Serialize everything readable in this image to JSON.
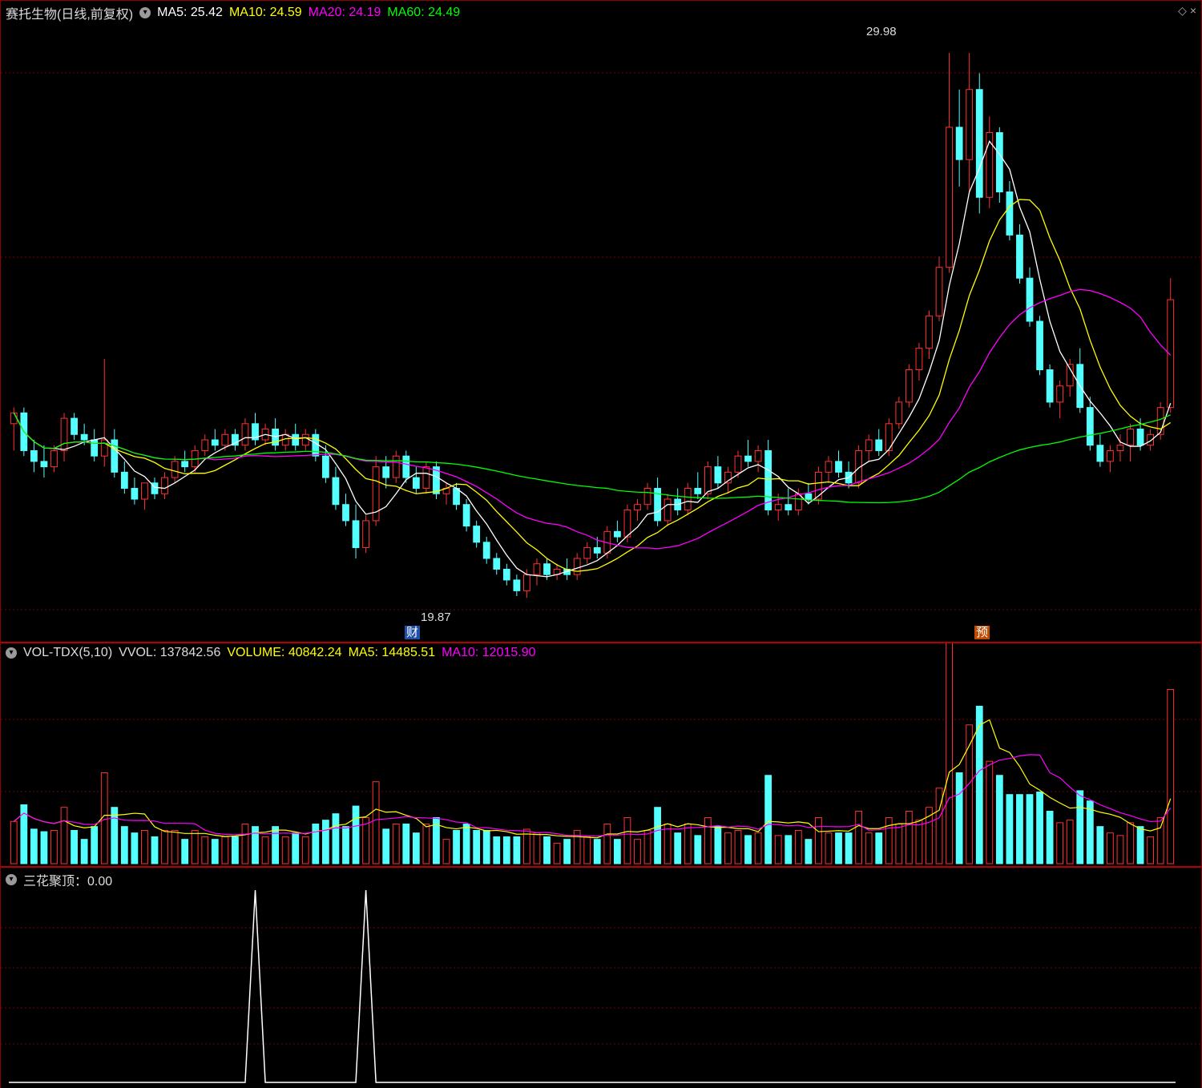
{
  "stock": {
    "title": "赛托生物(日线,前复权)",
    "ma_labels": [
      {
        "text": "MA5: 25.42",
        "color": "#ffffff"
      },
      {
        "text": "MA10: 24.59",
        "color": "#ffff00"
      },
      {
        "text": "MA20: 24.19",
        "color": "#ff00ff"
      },
      {
        "text": "MA60: 24.49",
        "color": "#00ff00"
      }
    ],
    "high_label": "29.98",
    "low_label": "19.87",
    "badge_cai": "财",
    "badge_yu": "预",
    "top_icons": "◇ ×"
  },
  "volume": {
    "name": "VOL-TDX(5,10)",
    "vvol": "VVOL: 137842.56",
    "labels": [
      {
        "text": "VOLUME: 40842.24",
        "color": "#ffff00"
      },
      {
        "text": "MA5: 14485.51",
        "color": "#ffff00"
      },
      {
        "text": "MA10: 12015.90",
        "color": "#ff00ff"
      }
    ]
  },
  "indicator": {
    "label": "三花聚顶：0.00",
    "spike_positions": [
      0.205,
      0.3
    ]
  },
  "colors": {
    "up": "#ff3232",
    "down": "#54ffff",
    "ma5": "#ffffff",
    "ma10": "#ffff00",
    "ma20": "#ff00ff",
    "ma60": "#00ff00"
  },
  "chart_data": {
    "type": "candlestick",
    "price_range": [
      19.5,
      30.5
    ],
    "candles": [
      [
        23.1,
        23.4,
        22.6,
        23.3
      ],
      [
        23.3,
        23.4,
        22.5,
        22.6
      ],
      [
        22.6,
        22.8,
        22.2,
        22.4
      ],
      [
        22.4,
        22.7,
        22.1,
        22.3
      ],
      [
        22.3,
        22.7,
        22.2,
        22.6
      ],
      [
        22.6,
        23.3,
        22.4,
        23.2
      ],
      [
        23.2,
        23.3,
        22.8,
        22.9
      ],
      [
        22.9,
        23.1,
        22.7,
        22.8
      ],
      [
        22.8,
        23.0,
        22.4,
        22.5
      ],
      [
        22.5,
        24.3,
        22.3,
        22.8
      ],
      [
        22.8,
        23.0,
        22.1,
        22.2
      ],
      [
        22.2,
        22.4,
        21.8,
        21.9
      ],
      [
        21.9,
        22.1,
        21.6,
        21.7
      ],
      [
        21.7,
        22.0,
        21.5,
        22.0
      ],
      [
        22.0,
        22.1,
        21.7,
        21.8
      ],
      [
        21.8,
        22.2,
        21.7,
        22.1
      ],
      [
        22.1,
        22.5,
        22.0,
        22.4
      ],
      [
        22.4,
        22.6,
        22.2,
        22.3
      ],
      [
        22.3,
        22.7,
        22.2,
        22.6
      ],
      [
        22.6,
        22.9,
        22.5,
        22.8
      ],
      [
        22.8,
        23.0,
        22.6,
        22.7
      ],
      [
        22.7,
        23.0,
        22.6,
        22.9
      ],
      [
        22.9,
        23.0,
        22.6,
        22.7
      ],
      [
        22.7,
        23.2,
        22.6,
        23.1
      ],
      [
        23.1,
        23.3,
        22.7,
        22.8
      ],
      [
        22.8,
        23.1,
        22.7,
        23.0
      ],
      [
        23.0,
        23.2,
        22.6,
        22.7
      ],
      [
        22.7,
        23.0,
        22.6,
        22.9
      ],
      [
        22.9,
        23.1,
        22.6,
        22.7
      ],
      [
        22.7,
        23.0,
        22.6,
        22.9
      ],
      [
        22.9,
        23.0,
        22.4,
        22.5
      ],
      [
        22.5,
        22.7,
        22.0,
        22.1
      ],
      [
        22.1,
        22.3,
        21.5,
        21.6
      ],
      [
        21.6,
        21.8,
        21.2,
        21.3
      ],
      [
        21.3,
        21.6,
        20.6,
        20.8
      ],
      [
        20.8,
        21.4,
        20.7,
        21.3
      ],
      [
        21.3,
        22.5,
        21.2,
        22.3
      ],
      [
        22.3,
        22.5,
        21.9,
        22.1
      ],
      [
        22.1,
        22.6,
        22.0,
        22.5
      ],
      [
        22.5,
        22.6,
        22.0,
        22.1
      ],
      [
        22.1,
        22.3,
        21.8,
        21.9
      ],
      [
        21.9,
        22.4,
        21.8,
        22.3
      ],
      [
        22.3,
        22.4,
        21.7,
        21.8
      ],
      [
        21.8,
        22.0,
        21.6,
        21.9
      ],
      [
        21.9,
        22.0,
        21.5,
        21.6
      ],
      [
        21.6,
        21.7,
        21.1,
        21.2
      ],
      [
        21.2,
        21.3,
        20.8,
        20.9
      ],
      [
        20.9,
        21.0,
        20.5,
        20.6
      ],
      [
        20.6,
        20.7,
        20.3,
        20.4
      ],
      [
        20.4,
        20.5,
        20.1,
        20.2
      ],
      [
        20.2,
        20.3,
        19.9,
        20.0
      ],
      [
        20.0,
        20.4,
        19.87,
        20.3
      ],
      [
        20.3,
        20.6,
        20.1,
        20.5
      ],
      [
        20.5,
        20.6,
        20.2,
        20.3
      ],
      [
        20.3,
        20.5,
        20.2,
        20.4
      ],
      [
        20.4,
        20.6,
        20.2,
        20.3
      ],
      [
        20.3,
        20.7,
        20.2,
        20.6
      ],
      [
        20.6,
        20.9,
        20.5,
        20.8
      ],
      [
        20.8,
        21.0,
        20.6,
        20.7
      ],
      [
        20.7,
        21.2,
        20.6,
        21.1
      ],
      [
        21.1,
        21.3,
        20.9,
        21.0
      ],
      [
        21.0,
        21.6,
        20.9,
        21.5
      ],
      [
        21.5,
        21.7,
        21.3,
        21.6
      ],
      [
        21.6,
        22.0,
        21.5,
        21.9
      ],
      [
        21.9,
        22.1,
        21.2,
        21.3
      ],
      [
        21.3,
        21.8,
        21.2,
        21.7
      ],
      [
        21.7,
        21.9,
        21.4,
        21.5
      ],
      [
        21.5,
        22.0,
        21.4,
        21.9
      ],
      [
        21.9,
        22.2,
        21.7,
        21.8
      ],
      [
        21.8,
        22.4,
        21.7,
        22.3
      ],
      [
        22.3,
        22.5,
        21.9,
        22.0
      ],
      [
        22.0,
        22.3,
        21.8,
        22.2
      ],
      [
        22.2,
        22.6,
        22.1,
        22.5
      ],
      [
        22.5,
        22.8,
        22.3,
        22.4
      ],
      [
        22.4,
        22.7,
        22.2,
        22.6
      ],
      [
        22.6,
        22.8,
        21.4,
        21.5
      ],
      [
        21.5,
        21.8,
        21.3,
        21.6
      ],
      [
        21.6,
        21.9,
        21.4,
        21.5
      ],
      [
        21.5,
        21.9,
        21.4,
        21.8
      ],
      [
        21.8,
        22.0,
        21.6,
        21.7
      ],
      [
        21.7,
        22.3,
        21.6,
        22.2
      ],
      [
        22.2,
        22.5,
        22.0,
        22.4
      ],
      [
        22.4,
        22.6,
        22.1,
        22.2
      ],
      [
        22.2,
        22.4,
        21.9,
        22.0
      ],
      [
        22.0,
        22.7,
        21.9,
        22.6
      ],
      [
        22.6,
        22.9,
        22.4,
        22.8
      ],
      [
        22.8,
        23.0,
        22.5,
        22.6
      ],
      [
        22.6,
        23.2,
        22.5,
        23.1
      ],
      [
        23.1,
        23.6,
        23.0,
        23.5
      ],
      [
        23.5,
        24.2,
        23.4,
        24.1
      ],
      [
        24.1,
        24.6,
        23.9,
        24.5
      ],
      [
        24.5,
        25.2,
        24.3,
        25.1
      ],
      [
        25.1,
        26.2,
        25.0,
        26.0
      ],
      [
        26.0,
        29.98,
        25.9,
        28.6
      ],
      [
        28.6,
        29.3,
        27.5,
        28.0
      ],
      [
        28.0,
        29.98,
        27.4,
        29.3
      ],
      [
        29.3,
        29.6,
        27.0,
        27.3
      ],
      [
        27.3,
        28.8,
        27.1,
        28.5
      ],
      [
        28.5,
        28.6,
        27.2,
        27.4
      ],
      [
        27.4,
        27.6,
        26.5,
        26.6
      ],
      [
        26.6,
        26.8,
        25.7,
        25.8
      ],
      [
        25.8,
        26.0,
        24.9,
        25.0
      ],
      [
        25.0,
        25.1,
        24.0,
        24.1
      ],
      [
        24.1,
        24.2,
        23.4,
        23.5
      ],
      [
        23.5,
        23.9,
        23.2,
        23.8
      ],
      [
        23.8,
        24.3,
        23.6,
        24.2
      ],
      [
        24.2,
        24.5,
        23.3,
        23.4
      ],
      [
        23.4,
        23.6,
        22.6,
        22.7
      ],
      [
        22.7,
        22.9,
        22.3,
        22.4
      ],
      [
        22.4,
        22.7,
        22.2,
        22.6
      ],
      [
        22.6,
        22.9,
        22.4,
        22.7
      ],
      [
        22.7,
        23.1,
        22.4,
        23.0
      ],
      [
        23.0,
        23.2,
        22.6,
        22.7
      ],
      [
        22.7,
        23.0,
        22.6,
        22.9
      ],
      [
        22.9,
        23.5,
        22.8,
        23.4
      ],
      [
        23.4,
        25.8,
        23.3,
        25.4
      ]
    ],
    "volume_max": 46000
  }
}
